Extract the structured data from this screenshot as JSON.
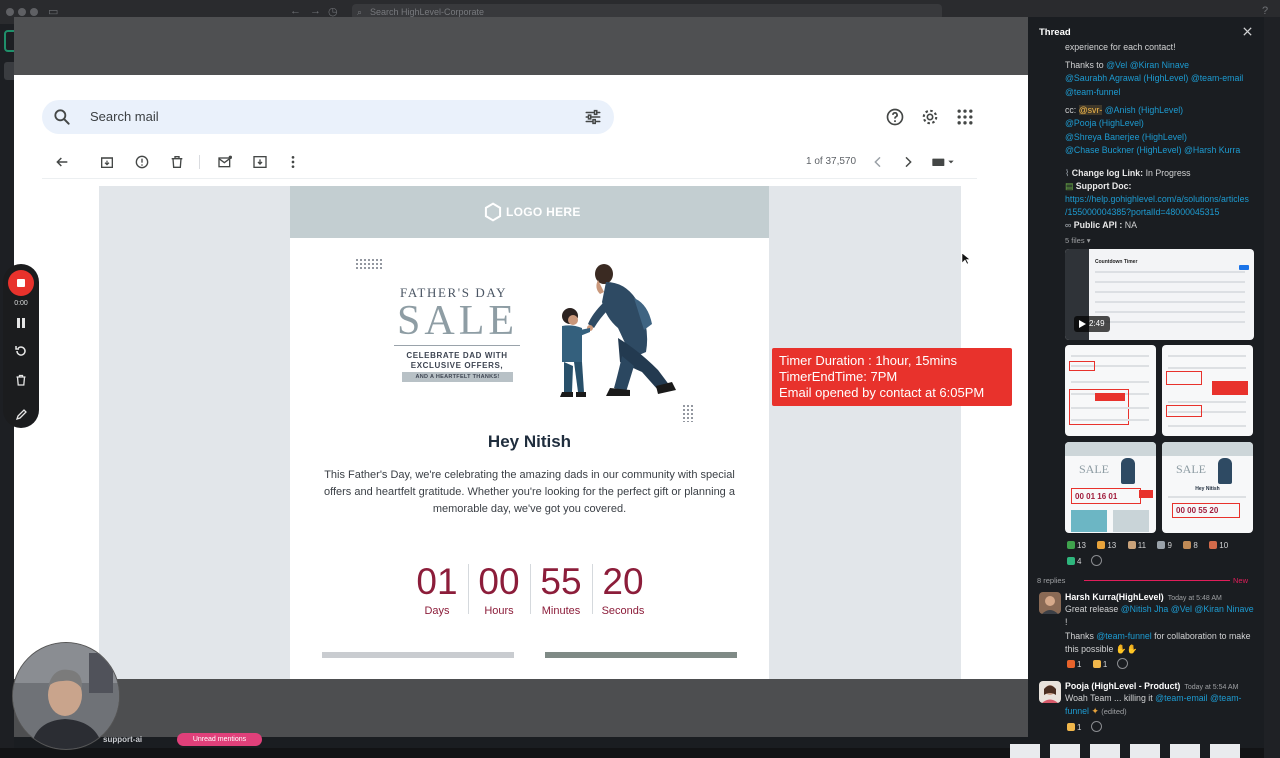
{
  "browser": {
    "address_placeholder": "Search HighLevel-Corporate"
  },
  "gmail": {
    "search_placeholder": "Search mail",
    "page_count": "1 of 37,570"
  },
  "email": {
    "logo_text": "LOGO HERE",
    "fathers_day": "FATHER'S DAY",
    "sale": "SALE",
    "celebrate_line1": "CELEBRATE DAD WITH",
    "celebrate_line2": "EXCLUSIVE OFFERS,",
    "tag": "AND A HEARTFELT THANKS!",
    "greeting": "Hey Nitish",
    "body": "This Father's Day, we're celebrating the amazing dads in our community with special offers and heartfelt gratitude. Whether you're looking for the perfect gift or planning a memorable day, we've got you covered.",
    "timer": [
      {
        "num": "01",
        "label": "Days"
      },
      {
        "num": "00",
        "label": "Hours"
      },
      {
        "num": "55",
        "label": "Minutes"
      },
      {
        "num": "20",
        "label": "Seconds"
      }
    ]
  },
  "annotation": {
    "line1": "Timer Duration : 1hour, 15mins",
    "line2": "TimerEndTime: 7PM",
    "line3": "Email opened by contact at 6:05PM"
  },
  "recorder": {
    "time": "0:00"
  },
  "behind": {
    "channel": "support-ai",
    "badge": "Unread mentions"
  },
  "thread": {
    "title": "Thread",
    "line_experience": "experience for each contact!",
    "thanks_to": "Thanks to",
    "m_vel": "@Vel",
    "m_kiran": "@Kiran Ninave",
    "m_saurabh": "@Saurabh Agrawal (HighLevel)",
    "m_team_email": "@team-email",
    "m_team_funnel": "@team-funnel",
    "cc": "cc:",
    "m_svr": "@svr-",
    "m_anish": "@Anish (HighLevel)",
    "m_pooja": "@Pooja (HighLevel)",
    "m_shreya": "@Shreya Banerjee (HighLevel)",
    "m_chase": "@Chase Buckner (HighLevel)",
    "m_harsh": "@Harsh Kurra",
    "changelog_label": "Change log Link:",
    "changelog_value": "In Progress",
    "support_label": "Support Doc:",
    "support_url1": "https://help.gohighlevel.com/a/solutions/articles",
    "support_url2": "/155000004385?portalId=48000045315",
    "api_label": "Public API :",
    "api_value": "NA",
    "files_label": "5 files",
    "video_title": "Countdown Timer",
    "video_duration": "2:49",
    "thumb_timer": "00 01 16 01",
    "thumb_timer2": "00 00 55 20",
    "thumb_greet": "Hey Nitish",
    "reactions": [
      {
        "color": "#3fa34d",
        "count": "13"
      },
      {
        "color": "#e8a33b",
        "count": "13"
      },
      {
        "color": "#c9a27a",
        "count": "11"
      },
      {
        "color": "#9aa2aa",
        "count": "9"
      },
      {
        "color": "#c08a55",
        "count": "8"
      },
      {
        "color": "#d26a4a",
        "count": "10"
      },
      {
        "color": "#2eb67d",
        "count": "4"
      }
    ],
    "replies": "8 replies",
    "new_label": "New",
    "msg1": {
      "name": "Harsh Kurra(HighLevel)",
      "time": "Today at 5:48 AM",
      "text1": "Great release",
      "m1": "@Nitish Jha",
      "m2": "@Vel",
      "m3": "@Kiran Ninave",
      "bang": "!",
      "text2": "Thanks",
      "m4": "@team-funnel",
      "text3": "for collaboration to make",
      "text4": "this possible",
      "r1": "1",
      "r2": "1"
    },
    "msg2": {
      "name": "Pooja (HighLevel - Product)",
      "time": "Today at 5:54 AM",
      "text1": "Woah Team ... killing it",
      "m1": "@team-email",
      "m2": "@team-",
      "m3": "funnel",
      "edited": "(edited)",
      "r1": "1"
    }
  }
}
